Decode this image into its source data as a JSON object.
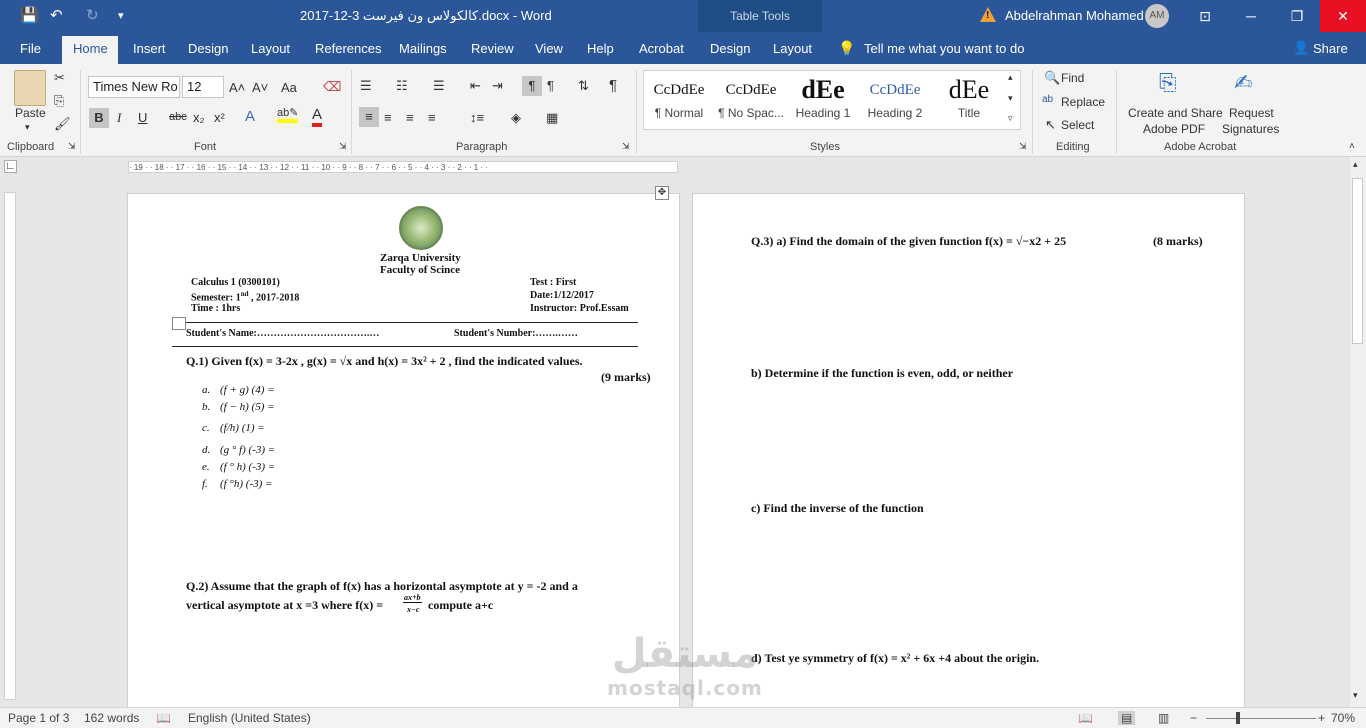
{
  "window": {
    "doc_title": "كالكولاس ون فيرست 3-12-2017.docx  -  Word",
    "table_tools": "Table Tools",
    "user": "Abdelrahman Mohamed",
    "avatar": "AM",
    "min": "─",
    "restore": "❐",
    "close": "✕",
    "ribbon_display": "⊡"
  },
  "tabs": [
    "File",
    "Home",
    "Insert",
    "Design",
    "Layout",
    "References",
    "Mailings",
    "Review",
    "View",
    "Help",
    "Acrobat",
    "Design",
    "Layout"
  ],
  "tellme": "Tell me what you want to do",
  "share": "Share",
  "clipboard": {
    "paste": "Paste",
    "label": "Clipboard"
  },
  "font": {
    "name": "Times New Ro",
    "size": "12",
    "label": "Font",
    "bold": "B",
    "italic": "I",
    "underline": "U",
    "strike": "abc",
    "sub": "x₂",
    "sup": "x²",
    "grow": "A˄",
    "shrink": "A˅",
    "case": "Aa",
    "clear": "⌫"
  },
  "paragraph": {
    "label": "Paragraph"
  },
  "styles": {
    "label": "Styles",
    "items": [
      {
        "preview": "CcDdEe",
        "name": "¶ Normal"
      },
      {
        "preview": "CcDdEe",
        "name": "¶ No Spac..."
      },
      {
        "preview": "dEe",
        "name": "Heading 1"
      },
      {
        "preview": "CcDdEe",
        "name": "Heading 2"
      },
      {
        "preview": "dEe",
        "name": "Title"
      }
    ]
  },
  "editing": {
    "find": "Find",
    "replace": "Replace",
    "select": "Select",
    "label": "Editing"
  },
  "acrobat": {
    "create": "Create and Share",
    "create2": "Adobe PDF",
    "request": "Request",
    "request2": "Signatures",
    "label": "Adobe Acrobat"
  },
  "hruler": "· 19 · · 18 · · 17 · · 16 · · 15 · · 14 · · 13 · · 12 · · 11 · · 10 · · 9 · · 8 · · 7 · · 6 · · 5 · · 4 · · 3 · · 2 · · 1 · · ",
  "page1": {
    "university": "Zarqa University",
    "faculty": "Faculty of Scince",
    "course": "Calculus 1 (0300101)",
    "semester": "Semester: 1",
    "semester_sup": "nd",
    "semester_rest": " , 2017-2018",
    "time": "Time : 1hrs",
    "test": "Test : First",
    "date": "Date:1/12/2017",
    "instructor": "Instructor: Prof.Essam",
    "student_name": "Student's Name:…………………………….…",
    "student_number": "Student's Number:…….……",
    "q1": "Q.1) Given f(x) = 3-2x , g(x) = √x  and h(x) = 3x² + 2 , find the indicated values.",
    "q1_marks": "(9 marks)",
    "items": [
      {
        "l": "a.",
        "t": "(f + g) (4) ="
      },
      {
        "l": "b.",
        "t": "(f − h) (5) ="
      },
      {
        "l": "c.",
        "t": "(f/h) (1) ="
      },
      {
        "l": "d.",
        "t": "(g ° f) (-3) ="
      },
      {
        "l": "e.",
        "t": "(f ° h) (-3) ="
      },
      {
        "l": "f.",
        "t": "(f °h) (-3) ="
      }
    ],
    "q2_line1": "Q.2) Assume that the graph of f(x) has a horizontal asymptote at y = -2 and a",
    "q2_line2a": "vertical asymptote at x =3 where f(x) =",
    "q2_frac_num": "ax+b",
    "q2_frac_den": "x−c",
    "q2_line2b": " compute a+c"
  },
  "page2": {
    "q3a": "Q.3) a) Find the domain  of the given function f(x) = √−x2 + 25",
    "q3_marks": "(8 marks)",
    "q3b": "b) Determine if the function is even, odd, or neither",
    "q3c": "c) Find the inverse of the function",
    "q3d": "d) Test ye symmetry of f(x) = x² + 6x +4 about the origin."
  },
  "status": {
    "page": "Page 1 of 3",
    "words": "162 words",
    "lang": "English (United States)",
    "zoom": "70%"
  },
  "watermark": {
    "ar": "مستقل",
    "en": "mostaql.com"
  }
}
